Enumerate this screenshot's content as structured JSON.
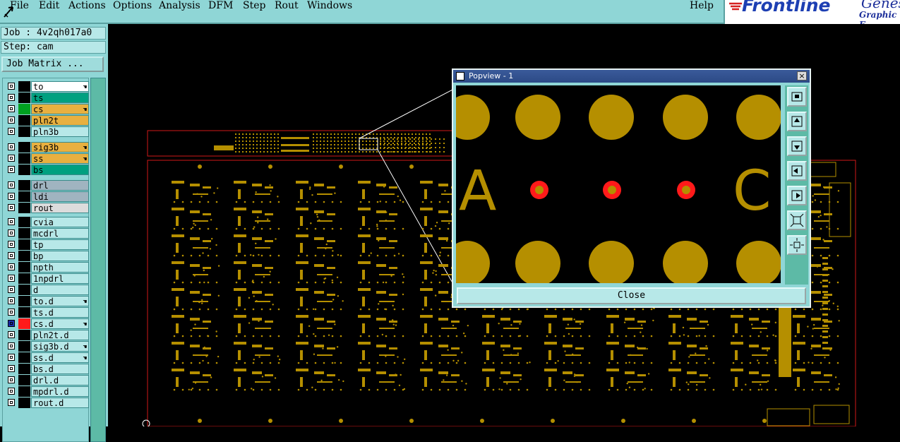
{
  "menubar": {
    "items": [
      "File",
      "Edit",
      "Actions",
      "Options",
      "Analysis",
      "DFM",
      "Step",
      "Rout",
      "Windows"
    ],
    "help": "Help"
  },
  "logo": {
    "brand": "Frontline",
    "product": "Genesis",
    "subtitle": "Graphic E"
  },
  "job": {
    "label": "Job : 4v2qh017a0",
    "step": "Step: cam",
    "matrix_button": "Job Matrix ..."
  },
  "layers": [
    {
      "name": "to",
      "color": "#ffffff",
      "hand": true
    },
    {
      "name": "ts",
      "color": "#00a080",
      "hand": false
    },
    {
      "name": "cs",
      "color": "#e8b040",
      "hand": true
    },
    {
      "name": "pln2t",
      "color": "#e8b040",
      "hand": false
    },
    {
      "name": "pln3b",
      "color": "#b7e8e8",
      "hand": false
    },
    {
      "name": "sig3b",
      "color": "#e8b040",
      "hand": true
    },
    {
      "name": "ss",
      "color": "#e8b040",
      "hand": true
    },
    {
      "name": "bs",
      "color": "#00a080",
      "hand": false
    },
    {
      "name": "drl",
      "color": "#a0b4c0",
      "hand": false
    },
    {
      "name": "ldi",
      "color": "#a0b4c0",
      "hand": false
    },
    {
      "name": "rout",
      "color": "#dcdcdc",
      "hand": false
    },
    {
      "name": "cvia",
      "color": "#b7e8e8",
      "hand": false
    },
    {
      "name": "mcdrl",
      "color": "#b7e8e8",
      "hand": false
    },
    {
      "name": "tp",
      "color": "#b7e8e8",
      "hand": false
    },
    {
      "name": "bp",
      "color": "#b7e8e8",
      "hand": false
    },
    {
      "name": "npth",
      "color": "#b7e8e8",
      "hand": false
    },
    {
      "name": "1npdrl",
      "color": "#b7e8e8",
      "hand": false
    },
    {
      "name": "d",
      "color": "#b7e8e8",
      "hand": false
    },
    {
      "name": "to.d",
      "color": "#b7e8e8",
      "hand": true
    },
    {
      "name": "ts.d",
      "color": "#b7e8e8",
      "hand": false
    },
    {
      "name": "cs.d",
      "color": "#b7e8e8",
      "hand": true
    },
    {
      "name": "pln2t.d",
      "color": "#b7e8e8",
      "hand": false
    },
    {
      "name": "sig3b.d",
      "color": "#b7e8e8",
      "hand": true
    },
    {
      "name": "ss.d",
      "color": "#b7e8e8",
      "hand": true
    },
    {
      "name": "bs.d",
      "color": "#b7e8e8",
      "hand": false
    },
    {
      "name": "drl.d",
      "color": "#b7e8e8",
      "hand": false
    },
    {
      "name": "mpdrl.d",
      "color": "#b7e8e8",
      "hand": false
    },
    {
      "name": "rout.d",
      "color": "#b7e8e8",
      "hand": false
    }
  ],
  "popview": {
    "title": "Popview - 1",
    "close_button": "Close",
    "labels": [
      "A",
      "C"
    ],
    "close_x": "×"
  },
  "colors": {
    "pad": "#b58f00",
    "via_ring": "#ff1a1a",
    "panel": "#8fd6d6",
    "active_color_cs_d": "#ff1a1a"
  }
}
